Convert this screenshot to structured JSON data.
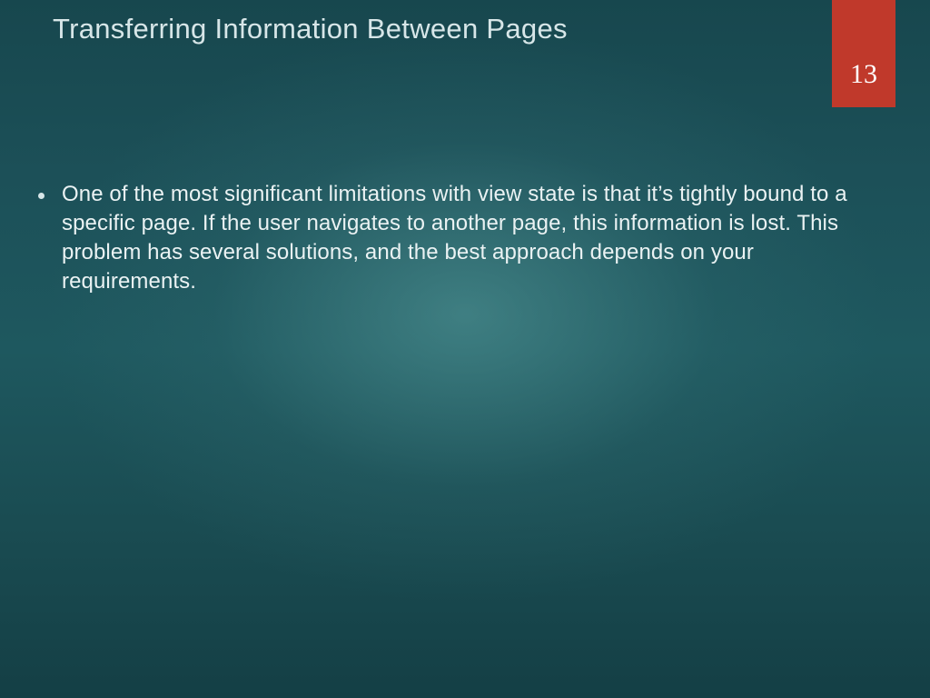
{
  "slide": {
    "title": "Transferring Information Between Pages",
    "page_number": "13",
    "bullets": [
      "One of the most significant limitations with view state is that it’s tightly bound to a specific page. If the user navigates to another page, this information is lost. This problem has several solutions, and the best approach depends on your requirements."
    ]
  },
  "colors": {
    "badge": "#c0392b",
    "text": "#eaf2f3",
    "bg_center": "#2f7a7d",
    "bg_edge": "#153f45"
  }
}
